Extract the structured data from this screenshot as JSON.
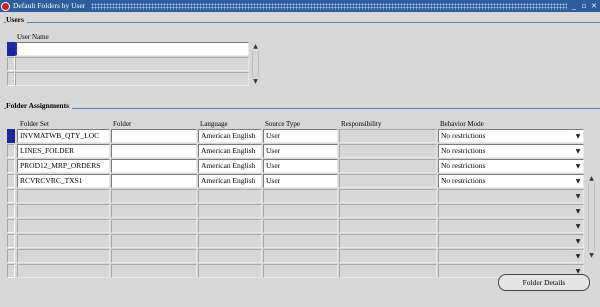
{
  "window": {
    "title": "Default Folders by User",
    "minimize": "_",
    "maximize": "▫",
    "close": "✕"
  },
  "users": {
    "section_label": "Users",
    "column_header": "User Name",
    "rows": [
      "",
      "",
      ""
    ]
  },
  "folder_assignments": {
    "section_label": "Folder Assignments",
    "columns": {
      "folder_set": "Folder Set",
      "folder": "Folder",
      "language": "Language",
      "source_type": "Source Type",
      "responsibility": "Responsibility",
      "behavior_mode": "Behavior Mode"
    },
    "rows": [
      {
        "folder_set": "INVMATWB_QTY_LOC",
        "folder": "",
        "language": "American English",
        "source_type": "User",
        "responsibility": "",
        "behavior_mode": "No restrictions"
      },
      {
        "folder_set": "LINES_FOLDER",
        "folder": "",
        "language": "American English",
        "source_type": "User",
        "responsibility": "",
        "behavior_mode": "No restrictions"
      },
      {
        "folder_set": "PROD12_MRP_ORDERS",
        "folder": "",
        "language": "American English",
        "source_type": "User",
        "responsibility": "",
        "behavior_mode": "No restrictions"
      },
      {
        "folder_set": "RCVRCVRC_TXS1",
        "folder": "",
        "language": "American English",
        "source_type": "User",
        "responsibility": "",
        "behavior_mode": "No restrictions"
      },
      {
        "folder_set": "",
        "folder": "",
        "language": "",
        "source_type": "",
        "responsibility": "",
        "behavior_mode": ""
      },
      {
        "folder_set": "",
        "folder": "",
        "language": "",
        "source_type": "",
        "responsibility": "",
        "behavior_mode": ""
      },
      {
        "folder_set": "",
        "folder": "",
        "language": "",
        "source_type": "",
        "responsibility": "",
        "behavior_mode": ""
      },
      {
        "folder_set": "",
        "folder": "",
        "language": "",
        "source_type": "",
        "responsibility": "",
        "behavior_mode": ""
      },
      {
        "folder_set": "",
        "folder": "",
        "language": "",
        "source_type": "",
        "responsibility": "",
        "behavior_mode": ""
      },
      {
        "folder_set": "",
        "folder": "",
        "language": "",
        "source_type": "",
        "responsibility": "",
        "behavior_mode": ""
      }
    ]
  },
  "buttons": {
    "folder_details": "Folder Details"
  },
  "colors": {
    "titlebar": "#2d5d9c",
    "background": "#d7d7d7",
    "active_row": "#1a2a9a"
  }
}
